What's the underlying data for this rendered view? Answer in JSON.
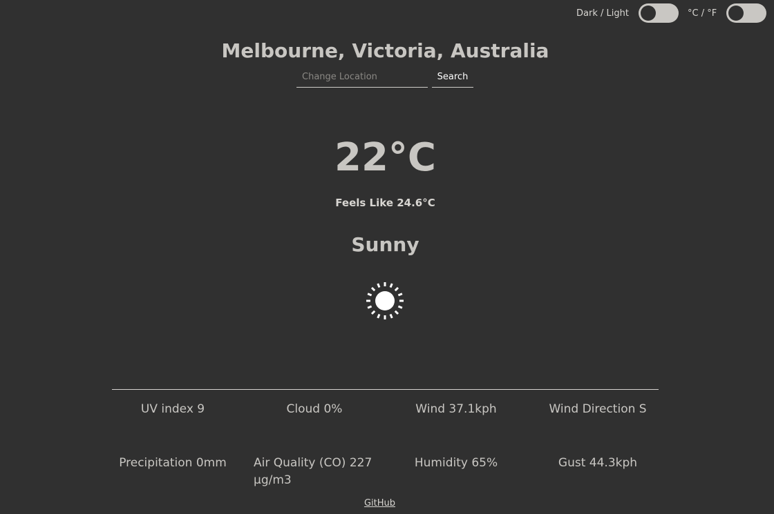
{
  "toggles": {
    "theme_label": "Dark / Light",
    "units_label": "°C / °F"
  },
  "header": {
    "location": "Melbourne, Victoria, Australia",
    "search_placeholder": "Change Location",
    "search_value": "",
    "search_button": "Search"
  },
  "current": {
    "temperature": "22°C",
    "feels_like": "Feels Like 24.6°C",
    "condition": "Sunny",
    "icon": "sun-icon"
  },
  "stats": [
    "UV index 9",
    "Cloud 0%",
    "Wind 37.1kph",
    "Wind Direction S",
    "Precipitation 0mm",
    "Air Quality (CO) 227 µg/m3",
    "Humidity 65%",
    "Gust 44.3kph"
  ],
  "footer": {
    "github": "GitHub"
  },
  "colors": {
    "background": "#303030",
    "text": "#c8c6c2",
    "toggle_track": "#c9c7c3"
  }
}
